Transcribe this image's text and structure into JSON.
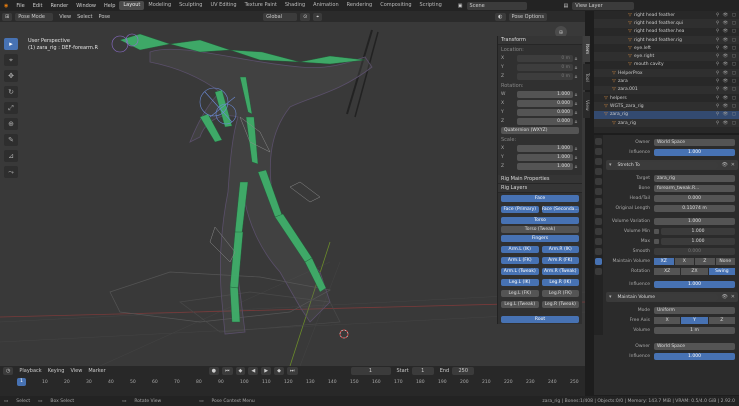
{
  "app": {
    "menus": [
      "File",
      "Edit",
      "Render",
      "Window",
      "Help"
    ],
    "workspaces": [
      {
        "label": "Layout",
        "active": true
      },
      {
        "label": "Modeling",
        "active": false
      },
      {
        "label": "Sculpting",
        "active": false
      },
      {
        "label": "UV Editing",
        "active": false
      },
      {
        "label": "Texture Paint",
        "active": false
      },
      {
        "label": "Shading",
        "active": false
      },
      {
        "label": "Animation",
        "active": false
      },
      {
        "label": "Rendering",
        "active": false
      },
      {
        "label": "Compositing",
        "active": false
      },
      {
        "label": "Scripting",
        "active": false
      }
    ],
    "scene": "Scene",
    "view_layer": "View Layer"
  },
  "viewport_header": {
    "mode": "Pose Mode",
    "menus": [
      "View",
      "Select",
      "Pose"
    ],
    "transform_orientation": "Global",
    "pose_options": "Pose Options"
  },
  "viewport": {
    "perspective": "User Perspective",
    "object_line": "(1) zara_rig : DEF-forearm.R"
  },
  "npanel": {
    "tabs": [
      "Item",
      "Tool",
      "View"
    ],
    "transform_title": "Transform",
    "location_label": "Location:",
    "location": [
      {
        "axis": "X",
        "value": "0 m"
      },
      {
        "axis": "Y",
        "value": "0 m"
      },
      {
        "axis": "Z",
        "value": "0 m"
      }
    ],
    "rotation_label": "Rotation:",
    "rotation": [
      {
        "axis": "W",
        "value": "1.000"
      },
      {
        "axis": "X",
        "value": "0.000"
      },
      {
        "axis": "Y",
        "value": "0.000"
      },
      {
        "axis": "Z",
        "value": "0.000"
      }
    ],
    "rotation_mode": "Quaternion (WXYZ)",
    "scale_label": "Scale:",
    "scale": [
      {
        "axis": "X",
        "value": "1.000"
      },
      {
        "axis": "Y",
        "value": "1.000"
      },
      {
        "axis": "Z",
        "value": "1.000"
      }
    ],
    "rig_main_props": "Rig Main Properties",
    "rig_layers": "Rig Layers",
    "layers": {
      "face": "Face",
      "face_primary": "Face (Primary)",
      "face_secondary": "Face (Seconda...",
      "torso": "Torso",
      "torso_tweak": "Torso (Tweak)",
      "fingers": "Fingers",
      "arm_l_ik": "Arm.L (IK)",
      "arm_r_ik": "Arm.R (IK)",
      "arm_l_fk": "Arm.L (FK)",
      "arm_r_fk": "Arm.R (FK)",
      "arm_l_tweak": "Arm.L (Tweak)",
      "arm_r_tweak": "Arm.R (Tweak)",
      "leg_l_ik": "Leg.L (IK)",
      "leg_r_ik": "Leg.R (IK)",
      "leg_l_fk": "Leg.L (FK)",
      "leg_r_fk": "Leg.R (FK)",
      "leg_l_tweak": "Leg.L (Tweak)",
      "leg_r_tweak": "Leg.R (Tweak)",
      "root": "Root"
    }
  },
  "outliner": {
    "rows": [
      {
        "label": "right head feather",
        "indent": 4,
        "sel": false
      },
      {
        "label": "right head feather.qui",
        "indent": 4,
        "sel": false
      },
      {
        "label": "right head feather.hea",
        "indent": 4,
        "sel": false
      },
      {
        "label": "right head feather.rig",
        "indent": 4,
        "sel": false
      },
      {
        "label": "eye.left",
        "indent": 4,
        "sel": false
      },
      {
        "label": "eye.right",
        "indent": 4,
        "sel": false
      },
      {
        "label": "mouth cavity",
        "indent": 4,
        "sel": false
      },
      {
        "label": "HelperProx",
        "indent": 2,
        "sel": false
      },
      {
        "label": "zara",
        "indent": 2,
        "sel": false
      },
      {
        "label": "zara.001",
        "indent": 2,
        "sel": false
      },
      {
        "label": "helpers",
        "indent": 1,
        "sel": false
      },
      {
        "label": "WGTS_zara_rig",
        "indent": 1,
        "sel": false
      },
      {
        "label": "zara_rig",
        "indent": 1,
        "sel": true
      },
      {
        "label": "zara_rig",
        "indent": 2,
        "sel": false
      }
    ]
  },
  "props": {
    "owner_label": "Owner",
    "owner_value": "World Space",
    "influence_label": "Influence",
    "influence_value": "1.000",
    "stretch_to": "Stretch To",
    "target_label": "Target",
    "target_value": "zara_rig",
    "bone_label": "Bone",
    "bone_value": "forearm_tweak.R...",
    "headtail_label": "Head/Tail",
    "headtail_value": "0.000",
    "orig_len_label": "Original Length",
    "orig_len_value": "0.11074 m",
    "vol_var_label": "Volume Variation",
    "vol_var_value": "1.000",
    "vol_min_label": "Volume Min",
    "vol_min_value": "1.000",
    "max_label": "Max",
    "max_value": "1.000",
    "smooth_label": "Smooth",
    "smooth_value": "0.000",
    "maintain_vol_label": "Maintain Volume",
    "maintain_vol": [
      {
        "label": "XZ",
        "on": true
      },
      {
        "label": "X",
        "on": false
      },
      {
        "label": "Z",
        "on": false
      },
      {
        "label": "None",
        "on": false
      }
    ],
    "rotation_label": "Rotation",
    "rotation": [
      {
        "label": "XZ",
        "on": false
      },
      {
        "label": "ZX",
        "on": false
      },
      {
        "label": "Swing",
        "on": true
      }
    ],
    "influence2_value": "1.000",
    "maintain_volume_con": "Maintain Volume",
    "mode_label": "Mode",
    "mode_value": "Uniform",
    "free_axis_label": "Free Axis",
    "free_axis": [
      {
        "label": "X",
        "on": false
      },
      {
        "label": "Y",
        "on": true
      },
      {
        "label": "Z",
        "on": false
      }
    ],
    "volume_label": "Volume",
    "volume_value": "1 m",
    "owner2_label": "Owner",
    "owner2_value": "World Space",
    "influence3_label": "Influence",
    "influence3_value": "1.000"
  },
  "timeline": {
    "menus": [
      "Playback",
      "Keying",
      "View",
      "Marker"
    ],
    "current_frame": "1",
    "start_label": "Start",
    "start": "1",
    "end_label": "End",
    "end": "250",
    "ticks": [
      "0",
      "10",
      "20",
      "30",
      "40",
      "50",
      "60",
      "70",
      "80",
      "90",
      "100",
      "110",
      "120",
      "130",
      "140",
      "150",
      "160",
      "170",
      "180",
      "190",
      "200",
      "210",
      "220",
      "230",
      "240",
      "250"
    ],
    "playhead": "1"
  },
  "status": {
    "select": "Select",
    "box_select": "Box Select",
    "rotate_view": "Rotate View",
    "pose_menu": "Pose Context Menu",
    "stats": "zara_rig | Bones:1/408 | Objects:0/0 | Memory: 143.7 MiB | VRAM: 0.5/4.0 GiB | 2.92.0"
  }
}
